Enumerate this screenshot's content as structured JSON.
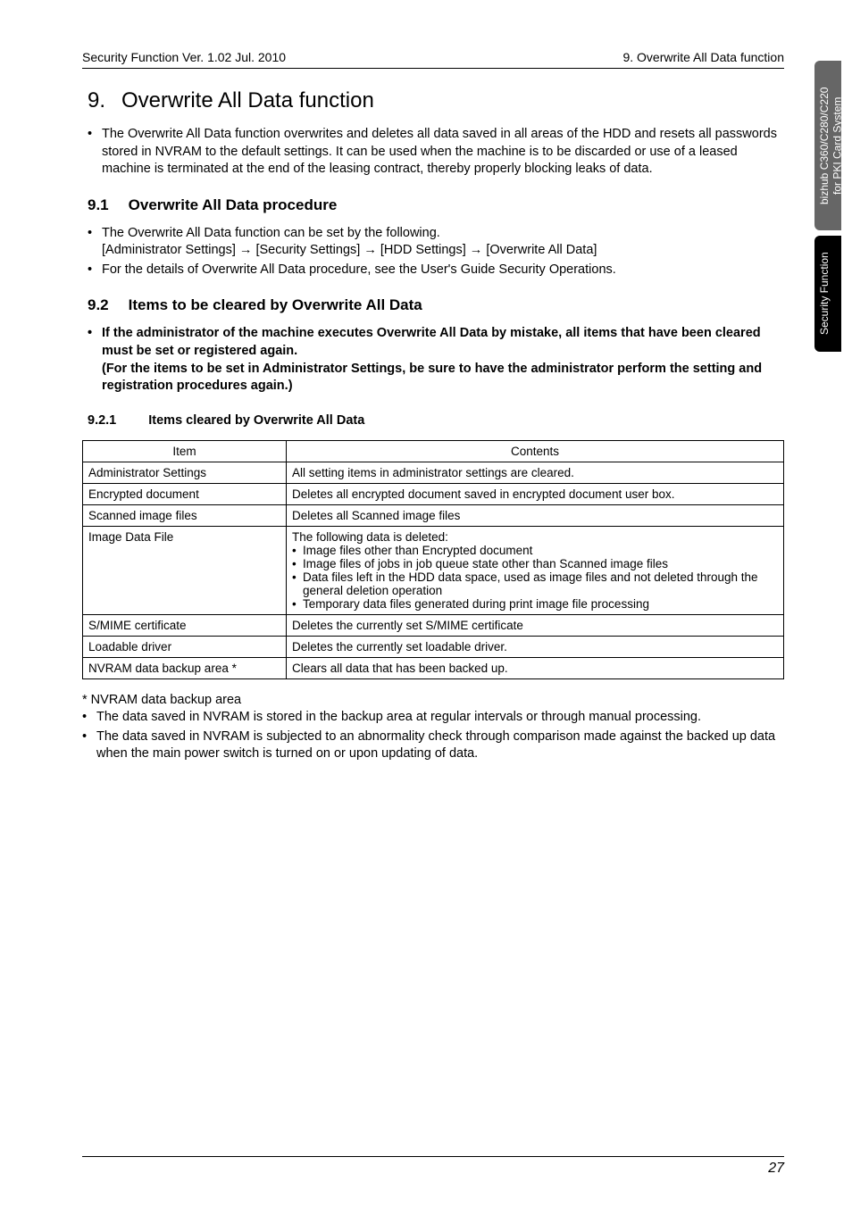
{
  "header": {
    "left": "Security Function Ver. 1.02 Jul. 2010",
    "right": "9. Overwrite All Data function"
  },
  "title": {
    "number": "9.",
    "text": "Overwrite All Data function"
  },
  "intro_bullet": "The Overwrite All Data function overwrites and deletes all data saved in all areas of the HDD and resets all passwords stored in NVRAM to the default settings. It can be used when the machine is to be discarded or use of a leased machine is terminated at the end of the leasing contract, thereby properly blocking leaks of data.",
  "s91": {
    "num": "9.1",
    "title": "Overwrite All Data procedure",
    "b1_line1": "The Overwrite All Data function can be set by the following.",
    "b1_line2": "[Administrator Settings] → [Security Settings] → [HDD Settings] → [Overwrite All Data]",
    "b2": "For the details of Overwrite All Data procedure, see the User's Guide Security Operations."
  },
  "s92": {
    "num": "9.2",
    "title": "Items to be cleared by Overwrite All Data",
    "note": "If the administrator of the machine executes Overwrite All Data by mistake, all items that have been cleared must be set or registered again.\n(For the items to be set in Administrator Settings, be sure to have the administrator perform the setting and registration procedures again.)"
  },
  "s921": {
    "num": "9.2.1",
    "title": "Items cleared by Overwrite All Data"
  },
  "table": {
    "head_item": "Item",
    "head_contents": "Contents",
    "rows": [
      {
        "item": "Administrator Settings",
        "contents_plain": "All setting items in administrator settings are cleared."
      },
      {
        "item": "Encrypted document",
        "contents_plain": "Deletes all encrypted document saved in encrypted document user box."
      },
      {
        "item": "Scanned image files",
        "contents_plain": "Deletes all Scanned image files"
      },
      {
        "item": "Image Data File",
        "contents_lead": "The following data is deleted:",
        "contents_bullets": [
          "Image files other than Encrypted document",
          "Image files of jobs in job queue state other than Scanned image files",
          "Data files left in the HDD data space, used as image files and not deleted through the general deletion operation",
          "Temporary data files generated during print image file processing"
        ]
      },
      {
        "item": "S/MIME certificate",
        "contents_plain": "Deletes the currently set S/MIME certificate"
      },
      {
        "item": "Loadable driver",
        "contents_plain": "Deletes the currently set loadable driver."
      },
      {
        "item": "NVRAM data backup area *",
        "contents_plain": "Clears all data that has been backed up."
      }
    ]
  },
  "footnote": {
    "lead": "* NVRAM data backup area",
    "b1": "The data saved in NVRAM is stored in the backup area at regular intervals or through manual processing.",
    "b2": "The data saved in NVRAM is subjected to an abnormality check through comparison made against the backed up data when the main power switch is turned on or upon updating of data."
  },
  "tabs": {
    "grey": "bizhub C360/C280/C220\nfor PKI Card System",
    "black": "Security Function"
  },
  "page_number": "27"
}
